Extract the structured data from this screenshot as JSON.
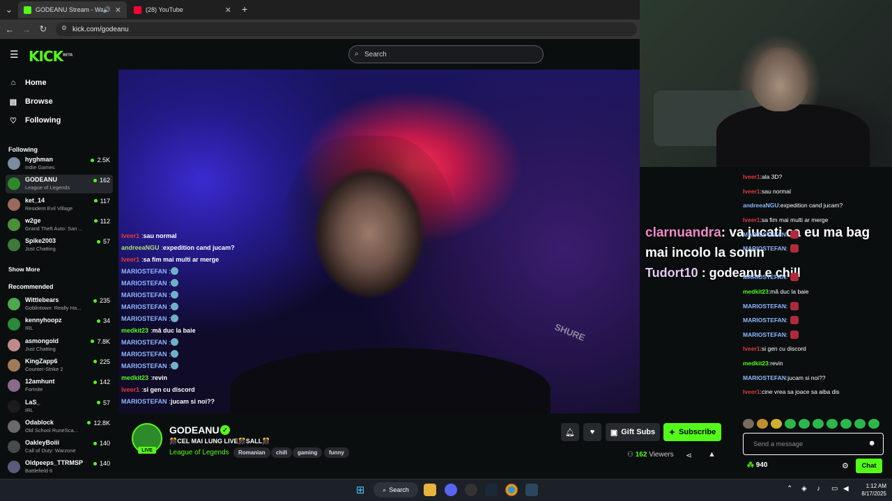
{
  "browser": {
    "tabs": [
      {
        "title": "GODEANU Stream - Watch",
        "active": true,
        "favicon_color": "#53fc18"
      },
      {
        "title": "(28) YouTube",
        "active": false,
        "favicon_color": "#ff0033"
      }
    ],
    "new_tab": "+",
    "url": "kick.com/godeanu"
  },
  "header": {
    "logo": "KICK",
    "logo_badge": "BETA",
    "search_placeholder": "Search"
  },
  "sidebar": {
    "nav": [
      {
        "label": "Home",
        "icon": "home-icon"
      },
      {
        "label": "Browse",
        "icon": "browse-icon"
      },
      {
        "label": "Following",
        "icon": "heart-icon"
      }
    ],
    "following_heading": "Following",
    "following": [
      {
        "name": "hyghman",
        "category": "Indie Games",
        "viewers": "2.5K",
        "color": "#7a8c9e"
      },
      {
        "name": "GODEANU",
        "category": "League of Legends",
        "viewers": "162",
        "color": "#2d8a2a",
        "selected": true
      },
      {
        "name": "ket_14",
        "category": "Resident Evil Village",
        "viewers": "117",
        "color": "#9a6a5a"
      },
      {
        "name": "w2ge",
        "category": "Grand Theft Auto: San ...",
        "viewers": "112",
        "color": "#4b8f3a"
      },
      {
        "name": "Spike2003",
        "category": "Just Chatting",
        "viewers": "57",
        "color": "#3a7a3a"
      }
    ],
    "show_more": "Show More",
    "recommended_heading": "Recommended",
    "recommended": [
      {
        "name": "Wittlebears",
        "category": "Goblintown: Really Ha...",
        "viewers": "235",
        "color": "#4ca84c"
      },
      {
        "name": "kennyhoopz",
        "category": "IRL",
        "viewers": "34",
        "color": "#2a8a3a"
      },
      {
        "name": "asmongold",
        "category": "Just Chatting",
        "viewers": "7.8K",
        "color": "#c08a8a"
      },
      {
        "name": "KingZapp6",
        "category": "Counter-Strike 2",
        "viewers": "225",
        "color": "#a07a5a"
      },
      {
        "name": "12amhunt",
        "category": "Fortnite",
        "viewers": "142",
        "color": "#8a6a8a"
      },
      {
        "name": "LaS_",
        "category": "IRL",
        "viewers": "57",
        "color": "#1c1c1c"
      },
      {
        "name": "Odablock",
        "category": "Old School RuneSca...",
        "viewers": "12.8K",
        "color": "#6a6a6a"
      },
      {
        "name": "OakleyBoiii",
        "category": "Call of Duty: Warzone",
        "viewers": "140",
        "color": "#4a4a4a"
      },
      {
        "name": "Oldpeeps_TTRMSP",
        "category": "Battlefield 6",
        "viewers": "140",
        "color": "#5a5a7a"
      }
    ]
  },
  "video": {
    "mic_brand": "SHURE",
    "overlay_chat": [
      {
        "user": "Iveer1",
        "text": "sau normal",
        "color": "#e23c3c"
      },
      {
        "user": "andreeaNGU",
        "text": "expedition cand jucam?",
        "color": "#a9e07a"
      },
      {
        "user": "Iveer1",
        "text": "sa fim mai multi ar merge",
        "color": "#e23c3c"
      },
      {
        "user": "MARIOSTEFAN",
        "text": "",
        "color": "#8fb8ff"
      },
      {
        "user": "MARIOSTEFAN",
        "text": "",
        "color": "#8fb8ff"
      },
      {
        "user": "MARIOSTEFAN",
        "text": "",
        "color": "#8fb8ff"
      },
      {
        "user": "MARIOSTEFAN",
        "text": "",
        "color": "#8fb8ff"
      },
      {
        "user": "MARIOSTEFAN",
        "text": "",
        "color": "#8fb8ff"
      },
      {
        "user": "medkit23",
        "text": "mă duc la baie",
        "color": "#53fc18"
      },
      {
        "user": "MARIOSTEFAN",
        "text": "",
        "color": "#8fb8ff"
      },
      {
        "user": "MARIOSTEFAN",
        "text": "",
        "color": "#8fb8ff"
      },
      {
        "user": "MARIOSTEFAN",
        "text": "",
        "color": "#8fb8ff"
      },
      {
        "user": "medkit23",
        "text": "revin",
        "color": "#53fc18"
      },
      {
        "user": "Iveer1",
        "text": "si gen cu discord",
        "color": "#e23c3c"
      },
      {
        "user": "MARIOSTEFAN",
        "text": "jucam si noi??",
        "color": "#8fb8ff"
      }
    ],
    "overlay_big": {
      "user1": "clarnuandra",
      "msg1": ": va jucati ca eu ma bag mai incolo la somn",
      "user2": "Tudort10",
      "msg2": ": godeanu e chill"
    }
  },
  "chat": {
    "messages": [
      {
        "user": "Iveer1",
        "text": "ala 3D?",
        "color": "#e23c3c"
      },
      {
        "user": "Iveer1",
        "text": "sau normal",
        "color": "#e23c3c"
      },
      {
        "user": "andreeaNGU",
        "text": "expedition cand jucam?",
        "color": "#8fb8ff"
      },
      {
        "user": "Iveer1",
        "text": "sa fim mai multi ar merge",
        "color": "#e23c3c"
      },
      {
        "user": "MARIOSTEFAN",
        "text": "",
        "color": "#8fb8ff"
      },
      {
        "user": "MARIOSTEFAN",
        "text": "",
        "color": "#8fb8ff"
      },
      {
        "user": "",
        "text": "",
        "color": "#8fb8ff"
      },
      {
        "user": "MARIOSTEFAN",
        "text": "",
        "color": "#8fb8ff"
      },
      {
        "user": "medkit23",
        "text": "mă duc la baie",
        "color": "#53fc18"
      },
      {
        "user": "MARIOSTEFAN",
        "text": "",
        "color": "#8fb8ff"
      },
      {
        "user": "MARIOSTEFAN",
        "text": "",
        "color": "#8fb8ff"
      },
      {
        "user": "MARIOSTEFAN",
        "text": "",
        "color": "#8fb8ff"
      },
      {
        "user": "Iveer1",
        "text": "si gen cu discord",
        "color": "#e23c3c"
      },
      {
        "user": "medkit23",
        "text": "revin",
        "color": "#53fc18"
      },
      {
        "user": "MARIOSTEFAN",
        "text": "jucam si noi??",
        "color": "#8fb8ff"
      },
      {
        "user": "Iveer1",
        "text": "cine vrea sa joace sa aiba dis",
        "color": "#e23c3c"
      }
    ],
    "input_placeholder": "Send a message",
    "points": "940",
    "chat_button": "Chat"
  },
  "stream": {
    "name": "GODEANU",
    "live_label": "LIVE",
    "title": "🎊CEL MAI LUNG LIVE🎊SALL🎊",
    "category": "League of Legends",
    "tags": [
      "Romanian",
      "chill",
      "gaming",
      "funny"
    ],
    "gift_label": "Gift Subs",
    "subscribe_label": "Subscribe",
    "viewers": "162",
    "viewers_label": "Viewers"
  },
  "taskbar": {
    "search_label": "Search",
    "time": "1:12 AM",
    "date": "8/17/2025"
  },
  "colors": {
    "accent": "#53fc18",
    "background": "#0b0e0f"
  }
}
